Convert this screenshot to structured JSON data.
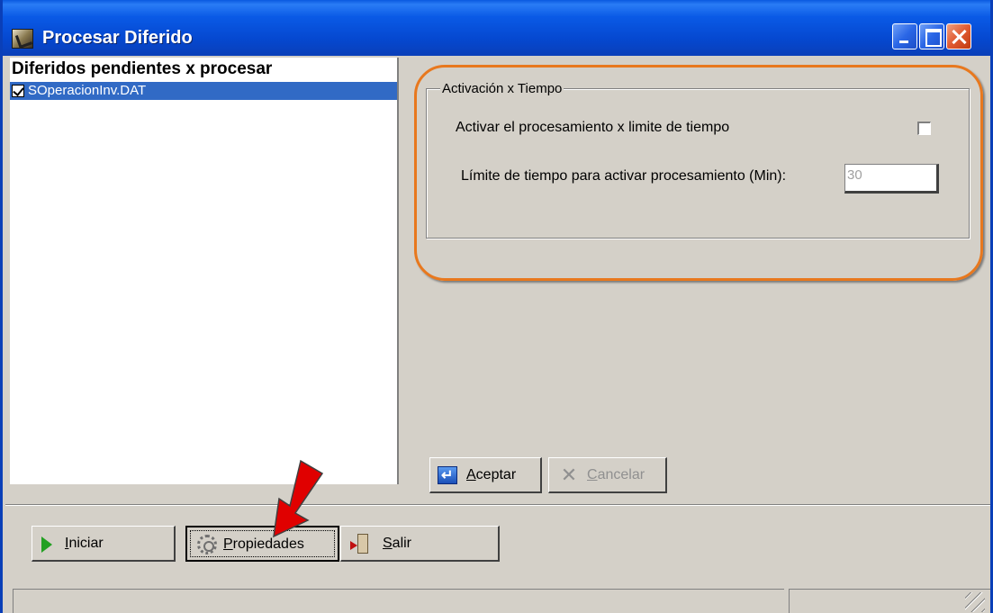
{
  "window": {
    "title": "Procesar Diferido",
    "icon": "app-window-icon",
    "controls": [
      "minimize",
      "maximize",
      "close"
    ]
  },
  "list": {
    "header": "Diferidos pendientes x procesar",
    "items": [
      {
        "label": "SOperacionInv.DAT",
        "checked": true,
        "selected": true
      }
    ]
  },
  "properties": {
    "group_title": "Activación x Tiempo",
    "activate_label": "Activar el procesamiento x limite de tiempo",
    "activate_checked": false,
    "limit_label": "Límite de tiempo para activar procesamiento (Min):",
    "limit_value": "30",
    "accept_label": "Aceptar",
    "accept_key": "A",
    "accept_rest": "ceptar",
    "cancel_key": "C",
    "cancel_rest": "ancelar",
    "cancel_enabled": false
  },
  "toolbar": {
    "start_key": "I",
    "start_rest": "niciar",
    "properties_key": "P",
    "properties_rest": "ropiedades",
    "exit_key": "S",
    "exit_rest": "alir"
  },
  "annotation": {
    "highlight_color": "#e8781e",
    "arrow_color": "#e00000"
  },
  "colors": {
    "titlebar": "#0a5ae0",
    "selection": "#316ac5",
    "face": "#d4d0c8"
  }
}
